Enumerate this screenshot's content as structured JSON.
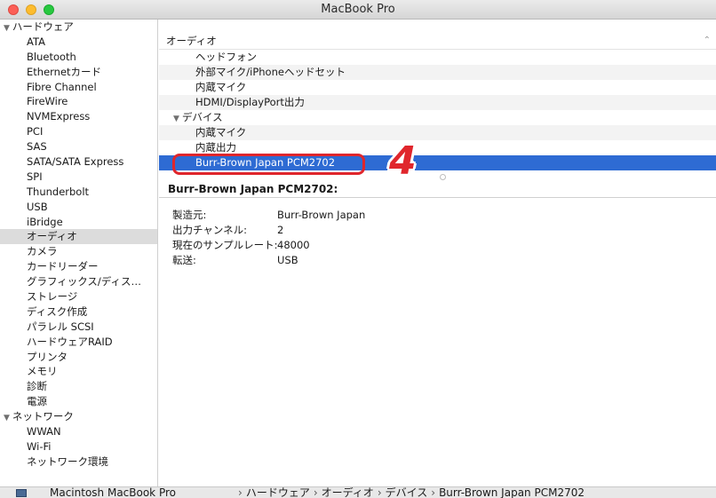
{
  "window": {
    "title": "MacBook Pro"
  },
  "sidebar": {
    "groups": [
      {
        "label": "ハードウェア",
        "items": [
          "ATA",
          "Bluetooth",
          "Ethernetカード",
          "Fibre Channel",
          "FireWire",
          "NVMExpress",
          "PCI",
          "SAS",
          "SATA/SATA Express",
          "SPI",
          "Thunderbolt",
          "USB",
          "iBridge",
          "オーディオ",
          "カメラ",
          "カードリーダー",
          "グラフィックス/ディス…",
          "ストレージ",
          "ディスク作成",
          "パラレル SCSI",
          "ハードウェアRAID",
          "プリンタ",
          "メモリ",
          "診断",
          "電源"
        ]
      },
      {
        "label": "ネットワーク",
        "items": [
          "WWAN",
          "Wi-Fi",
          "ネットワーク環境"
        ]
      }
    ],
    "selected": "オーディオ"
  },
  "main": {
    "header": "オーディオ",
    "tree": [
      {
        "label": "ヘッドフォン",
        "level": 2
      },
      {
        "label": "外部マイク/iPhoneヘッドセット",
        "level": 2
      },
      {
        "label": "内蔵マイク",
        "level": 2
      },
      {
        "label": "HDMI/DisplayPort出力",
        "level": 2
      },
      {
        "label": "デバイス",
        "level": 1
      },
      {
        "label": "内蔵マイク",
        "level": 2
      },
      {
        "label": "内蔵出力",
        "level": 2
      },
      {
        "label": "Burr-Brown Japan PCM2702",
        "level": 2,
        "selected": true
      }
    ],
    "detail_title": "Burr-Brown Japan PCM2702:",
    "details": [
      {
        "key": "製造元:",
        "value": "Burr-Brown Japan"
      },
      {
        "key": "出力チャンネル:",
        "value": "2"
      },
      {
        "key": "現在のサンプルレート:",
        "value": "48000"
      },
      {
        "key": "転送:",
        "value": "USB"
      }
    ]
  },
  "annotation": {
    "step": "4"
  },
  "statusbar": {
    "host": "Macintosh MacBook Pro",
    "breadcrumbs": [
      "ハードウェア",
      "オーディオ",
      "デバイス",
      "Burr-Brown Japan PCM2702"
    ]
  },
  "colors": {
    "selection": "#2e6bd3",
    "callout": "#e0262c"
  }
}
